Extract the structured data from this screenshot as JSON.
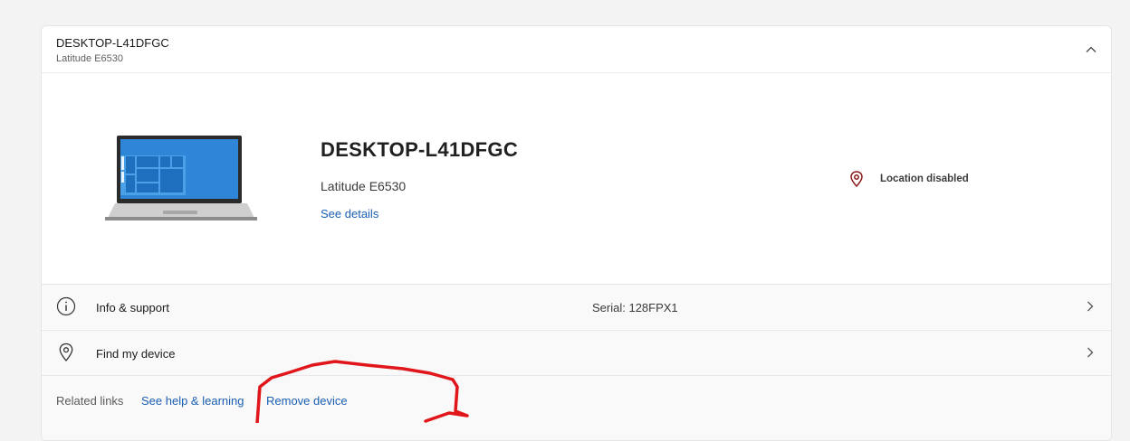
{
  "device_card": {
    "header_title": "DESKTOP-L41DFGC",
    "header_subtitle": "Latitude E6530",
    "collapse_icon": "chevron-up-icon"
  },
  "device": {
    "name": "DESKTOP-L41DFGC",
    "model": "Latitude E6530",
    "see_details_label": "See details",
    "image": "laptop-icon",
    "location_icon": "location-pin-icon",
    "location_status": "Location disabled",
    "location_icon_color": "#8b1a1a"
  },
  "rows": {
    "info_support": {
      "label": "Info & support",
      "serial": "Serial: 128FPX1",
      "icon": "info-icon"
    },
    "find_device": {
      "label": "Find my device",
      "icon": "location-pin-icon"
    }
  },
  "related_links": {
    "label": "Related links",
    "help_link": "See help & learning",
    "remove_link": "Remove device"
  },
  "colors": {
    "accent_link": "#1a5fb4",
    "annotation": "#e0161b",
    "screen_blue": "#2f86d8"
  }
}
